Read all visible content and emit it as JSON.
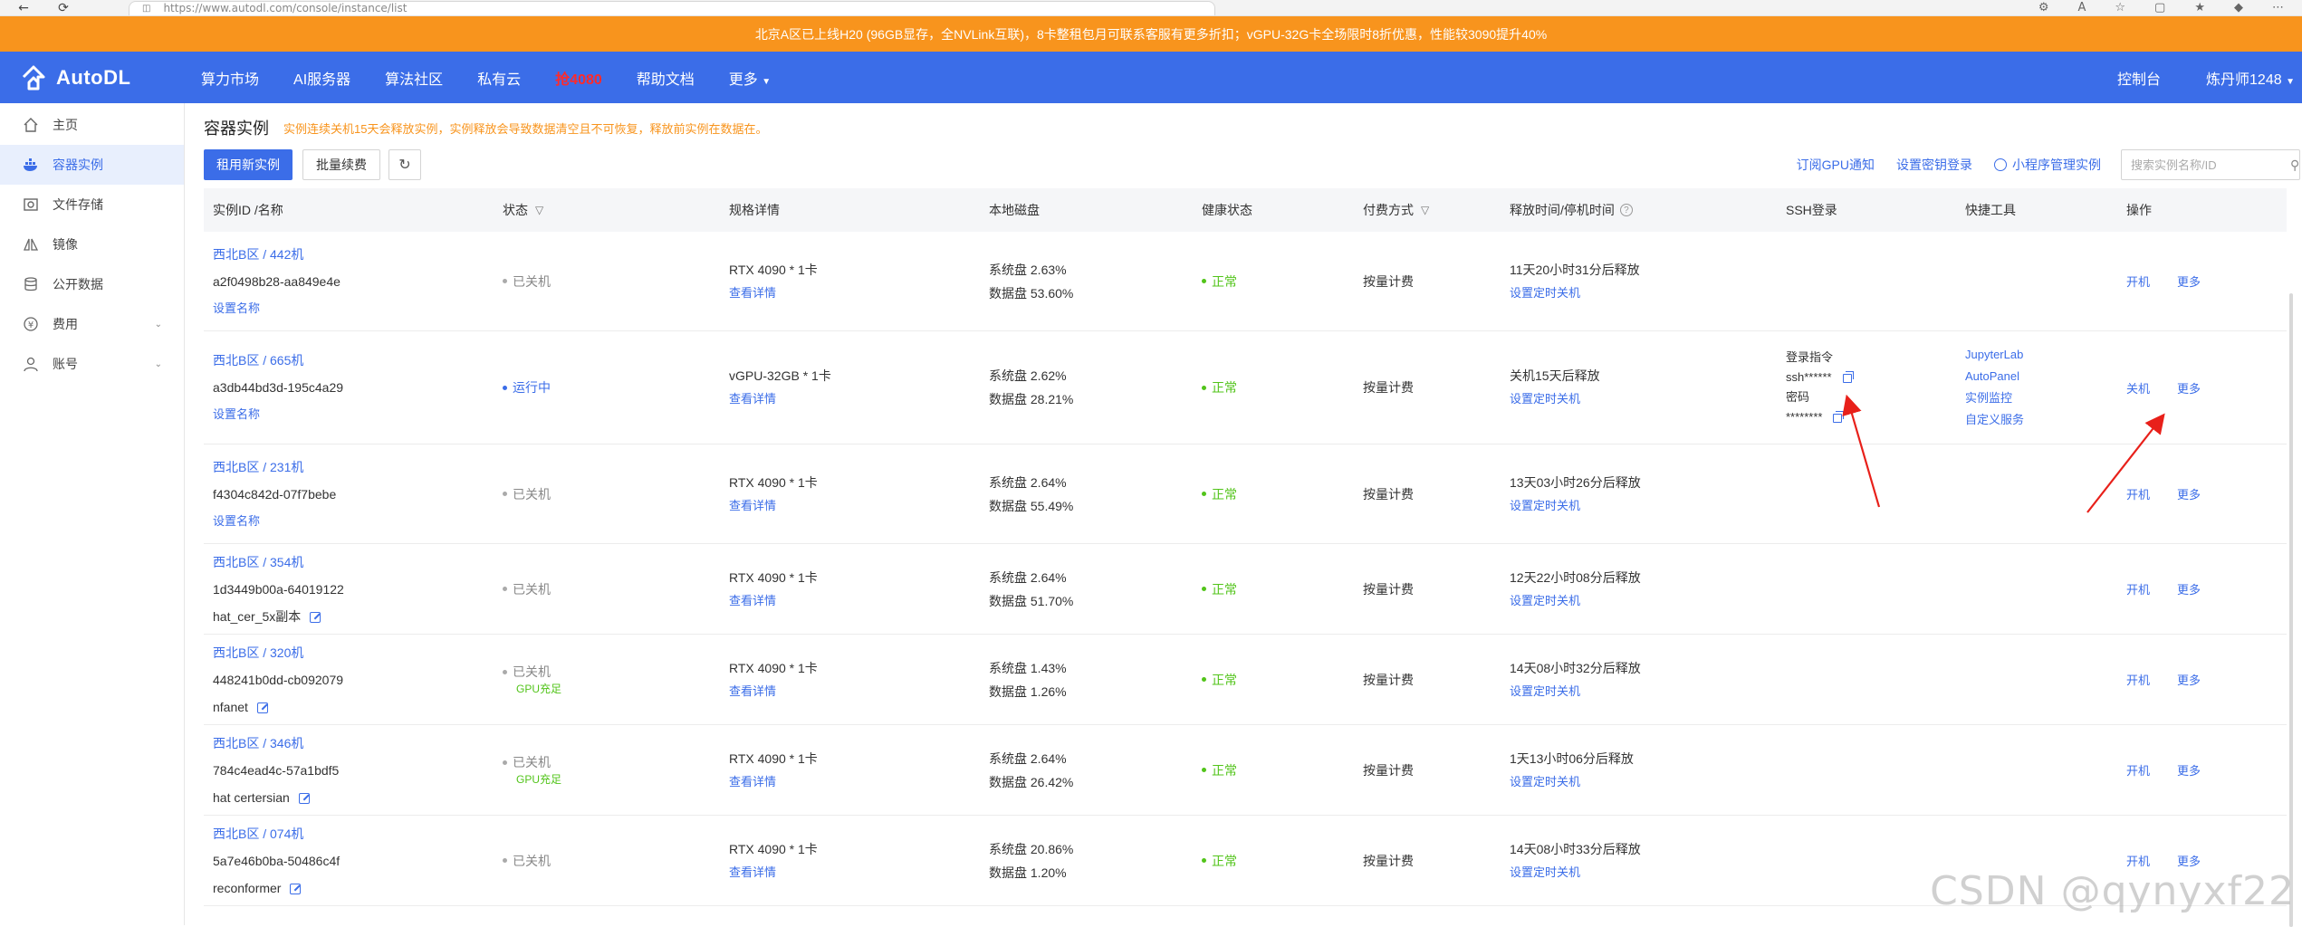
{
  "browser": {
    "url": "https://www.autodl.com/console/instance/list",
    "back_icon": "back-arrow-icon",
    "refresh_icon": "refresh-icon"
  },
  "notice": {
    "text": "北京A区已上线H20 (96GB显存，全NVLink互联)，8卡整租包月可联系客服有更多折扣；vGPU-32G卡全场限时8折优惠，性能较3090提升40%",
    "bg_color": "#f8941d"
  },
  "header": {
    "logo_text": "AutoDL",
    "nav": [
      "算力市场",
      "AI服务器",
      "算法社区",
      "私有云",
      "抢4080",
      "帮助文档",
      "更多"
    ],
    "console": "控制台",
    "user": "炼丹师1248",
    "bg_color": "#3b6de8"
  },
  "sidebar": {
    "items": [
      {
        "label": "主页",
        "icon": "home-icon"
      },
      {
        "label": "容器实例",
        "icon": "container-icon"
      },
      {
        "label": "文件存储",
        "icon": "storage-icon"
      },
      {
        "label": "镜像",
        "icon": "image-icon"
      },
      {
        "label": "公开数据",
        "icon": "database-icon"
      },
      {
        "label": "费用",
        "icon": "yen-icon"
      },
      {
        "label": "账号",
        "icon": "user-icon"
      }
    ]
  },
  "main": {
    "title": "容器实例",
    "warning": "实例连续关机15天会释放实例，实例释放会导致数据清空且不可恢复，释放前实例在数据在。",
    "rent_button": "租用新实例",
    "batch_renew_button": "批量续费",
    "subscribe_gpu": "订阅GPU通知",
    "set_key_login": "设置密钥登录",
    "miniapp_manage": "小程序管理实例",
    "search_placeholder": "搜索实例名称/ID"
  },
  "table": {
    "headers": [
      "实例ID /名称",
      "状态",
      "规格详情",
      "本地磁盘",
      "健康状态",
      "付费方式",
      "释放时间/停机时间",
      "SSH登录",
      "快捷工具",
      "操作"
    ],
    "rows": [
      {
        "region": "西北B区 / 442机",
        "id": "a2f0498b28-aa849e4e",
        "name": "设置名称",
        "name_is_link": true,
        "status": "已关机",
        "gpu_free": "",
        "spec": "RTX 4090 * 1卡",
        "spec_link": "查看详情",
        "sys_disk": "系统盘 2.63%",
        "data_disk": "数据盘 53.60%",
        "health": "正常",
        "pay": "按量计费",
        "release": "11天20小时31分后释放",
        "release_link": "设置定时关机",
        "op1": "开机",
        "op2": "更多"
      },
      {
        "region": "西北B区 / 665机",
        "id": "a3db44bd3d-195c4a29",
        "name": "设置名称",
        "name_is_link": true,
        "status": "运行中",
        "gpu_free": "",
        "spec": "vGPU-32GB * 1卡",
        "spec_link": "查看详情",
        "sys_disk": "系统盘 2.62%",
        "data_disk": "数据盘 28.21%",
        "health": "正常",
        "pay": "按量计费",
        "release": "关机15天后释放",
        "release_link": "设置定时关机",
        "ssh_label": "登录指令",
        "ssh_cmd": "ssh******",
        "pwd_label": "密码",
        "pwd": "********",
        "tools": [
          "JupyterLab",
          "AutoPanel",
          "实例监控",
          "自定义服务"
        ],
        "op1": "关机",
        "op2": "更多"
      },
      {
        "region": "西北B区 / 231机",
        "id": "f4304c842d-07f7bebe",
        "name": "设置名称",
        "name_is_link": true,
        "status": "已关机",
        "gpu_free": "",
        "spec": "RTX 4090 * 1卡",
        "spec_link": "查看详情",
        "sys_disk": "系统盘 2.64%",
        "data_disk": "数据盘 55.49%",
        "health": "正常",
        "pay": "按量计费",
        "release": "13天03小时26分后释放",
        "release_link": "设置定时关机",
        "op1": "开机",
        "op2": "更多"
      },
      {
        "region": "西北B区 / 354机",
        "id": "1d3449b00a-64019122",
        "name": "hat_cer_5x副本",
        "name_is_link": false,
        "status": "已关机",
        "gpu_free": "",
        "spec": "RTX 4090 * 1卡",
        "spec_link": "查看详情",
        "sys_disk": "系统盘 2.64%",
        "data_disk": "数据盘 51.70%",
        "health": "正常",
        "pay": "按量计费",
        "release": "12天22小时08分后释放",
        "release_link": "设置定时关机",
        "op1": "开机",
        "op2": "更多"
      },
      {
        "region": "西北B区 / 320机",
        "id": "448241b0dd-cb092079",
        "name": "nfanet",
        "name_is_link": false,
        "status": "已关机",
        "gpu_free": "GPU充足",
        "spec": "RTX 4090 * 1卡",
        "spec_link": "查看详情",
        "sys_disk": "系统盘 1.43%",
        "data_disk": "数据盘 1.26%",
        "health": "正常",
        "pay": "按量计费",
        "release": "14天08小时32分后释放",
        "release_link": "设置定时关机",
        "op1": "开机",
        "op2": "更多"
      },
      {
        "region": "西北B区 / 346机",
        "id": "784c4ead4c-57a1bdf5",
        "name": "hat certersian",
        "name_is_link": false,
        "status": "已关机",
        "gpu_free": "GPU充足",
        "spec": "RTX 4090 * 1卡",
        "spec_link": "查看详情",
        "sys_disk": "系统盘 2.64%",
        "data_disk": "数据盘 26.42%",
        "health": "正常",
        "pay": "按量计费",
        "release": "1天13小时06分后释放",
        "release_link": "设置定时关机",
        "op1": "开机",
        "op2": "更多"
      },
      {
        "region": "西北B区 / 074机",
        "id": "5a7e46b0ba-50486c4f",
        "name": "reconformer",
        "name_is_link": false,
        "status": "已关机",
        "gpu_free": "",
        "spec": "RTX 4090 * 1卡",
        "spec_link": "查看详情",
        "sys_disk": "系统盘 20.86%",
        "data_disk": "数据盘 1.20%",
        "health": "正常",
        "pay": "按量计费",
        "release": "14天08小时33分后释放",
        "release_link": "设置定时关机",
        "op1": "开机",
        "op2": "更多"
      }
    ]
  },
  "watermark": "CSDN @qynyxf22",
  "colors": {
    "accent": "#3b6de8",
    "ok": "#52c41a",
    "warn": "#f8941d",
    "annotation_arrow": "#e8201a"
  }
}
